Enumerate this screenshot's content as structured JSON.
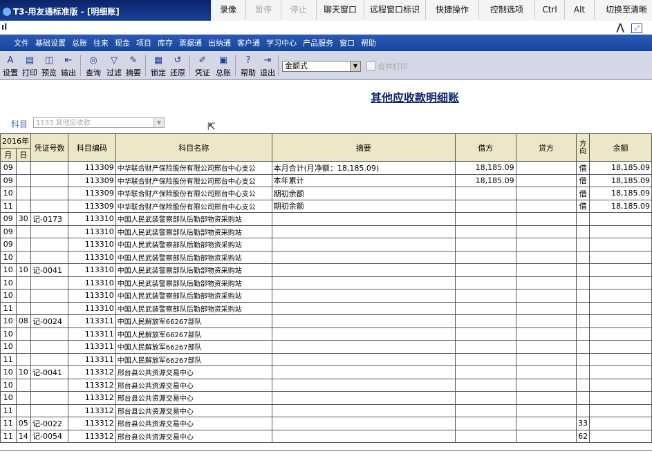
{
  "window": {
    "title": "T3-用友通标准版 - [明细账]"
  },
  "remote_toolbar": [
    {
      "label": "录像",
      "enabled": true
    },
    {
      "label": "暂停",
      "enabled": false
    },
    {
      "label": "停止",
      "enabled": false
    },
    {
      "label": "聊天窗口",
      "enabled": true
    },
    {
      "label": "远程窗口标识",
      "enabled": true
    },
    {
      "label": "快捷操作",
      "enabled": true
    },
    {
      "label": "控制选项",
      "enabled": true
    },
    {
      "label": "Ctrl",
      "enabled": true
    },
    {
      "label": "Alt",
      "enabled": true
    },
    {
      "label": "切换至清晰",
      "enabled": true
    }
  ],
  "menu": [
    "文件",
    "基础设置",
    "总账",
    "往来",
    "现金",
    "项目",
    "库存",
    "票据通",
    "出纳通",
    "客户通",
    "学习中心",
    "产品服务",
    "窗口",
    "帮助"
  ],
  "toolbar": {
    "buttons": [
      {
        "label": "设置",
        "icon": "settings-icon",
        "glyph": "A"
      },
      {
        "label": "打印",
        "icon": "printer-icon",
        "glyph": "▤"
      },
      {
        "label": "预览",
        "icon": "preview-icon",
        "glyph": "◫"
      },
      {
        "label": "输出",
        "icon": "export-icon",
        "glyph": "⇤"
      },
      {
        "label": "查询",
        "icon": "binoculars-icon",
        "glyph": "◎"
      },
      {
        "label": "过滤",
        "icon": "filter-icon",
        "glyph": "▽"
      },
      {
        "label": "摘要",
        "icon": "summary-icon",
        "glyph": "✎"
      },
      {
        "label": "锁定",
        "icon": "lock-icon",
        "glyph": "▦"
      },
      {
        "label": "还原",
        "icon": "restore-icon",
        "glyph": "↺"
      },
      {
        "label": "凭证",
        "icon": "voucher-icon",
        "glyph": "✐"
      },
      {
        "label": "总账",
        "icon": "ledger-icon",
        "glyph": "▣"
      },
      {
        "label": "帮助",
        "icon": "help-icon",
        "glyph": "?"
      },
      {
        "label": "退出",
        "icon": "exit-icon",
        "glyph": "⇥"
      }
    ],
    "format_select": "金额式",
    "merge_print_label": "合并打印"
  },
  "report": {
    "title": "其他应收款明细账",
    "subject_label": "科目",
    "subject_value": "1133 其他应收款"
  },
  "table": {
    "headers": {
      "year": "2016年",
      "month": "月",
      "day": "日",
      "voucher": "凭证号数",
      "code": "科目编码",
      "name": "科目名称",
      "summary": "摘要",
      "debit": "借方",
      "credit": "贷方",
      "direction": "方向",
      "balance": "余额"
    },
    "rows": [
      {
        "m": "09",
        "d": "",
        "v": "",
        "code": "113309",
        "name": "中华联合财产保险股份有限公司邢台中心支公",
        "sum": "本月合计(月净额：18,185.09)",
        "debit": "18,185.09",
        "credit": "",
        "dir": "借",
        "bal": "18,185.09"
      },
      {
        "m": "09",
        "d": "",
        "v": "",
        "code": "113309",
        "name": "中华联合财产保险股份有限公司邢台中心支公",
        "sum": "本年累计",
        "debit": "18,185.09",
        "credit": "",
        "dir": "借",
        "bal": "18,185.09"
      },
      {
        "m": "10",
        "d": "",
        "v": "",
        "code": "113309",
        "name": "中华联合财产保险股份有限公司邢台中心支公",
        "sum": "期初余额",
        "debit": "",
        "credit": "",
        "dir": "借",
        "bal": "18,185.09"
      },
      {
        "m": "11",
        "d": "",
        "v": "",
        "code": "113309",
        "name": "中华联合财产保险股份有限公司邢台中心支公",
        "sum": "期初余额",
        "debit": "",
        "credit": "",
        "dir": "借",
        "bal": "18,185.09"
      },
      {
        "m": "09",
        "d": "30",
        "v": "记-0173",
        "code": "113310",
        "name": "中国人民武装警察部队后勤部物资采购站",
        "sum": "",
        "debit": "",
        "credit": "",
        "dir": "",
        "bal": ""
      },
      {
        "m": "09",
        "d": "",
        "v": "",
        "code": "113310",
        "name": "中国人民武装警察部队后勤部物资采购站",
        "sum": "",
        "debit": "",
        "credit": "",
        "dir": "",
        "bal": ""
      },
      {
        "m": "09",
        "d": "",
        "v": "",
        "code": "113310",
        "name": "中国人民武装警察部队后勤部物资采购站",
        "sum": "",
        "debit": "",
        "credit": "",
        "dir": "",
        "bal": ""
      },
      {
        "m": "10",
        "d": "",
        "v": "",
        "code": "113310",
        "name": "中国人民武装警察部队后勤部物资采购站",
        "sum": "",
        "debit": "",
        "credit": "",
        "dir": "",
        "bal": ""
      },
      {
        "m": "10",
        "d": "10",
        "v": "记-0041",
        "code": "113310",
        "name": "中国人民武装警察部队后勤部物资采购站",
        "sum": "",
        "debit": "",
        "credit": "",
        "dir": "",
        "bal": ""
      },
      {
        "m": "10",
        "d": "",
        "v": "",
        "code": "113310",
        "name": "中国人民武装警察部队后勤部物资采购站",
        "sum": "",
        "debit": "",
        "credit": "",
        "dir": "",
        "bal": ""
      },
      {
        "m": "10",
        "d": "",
        "v": "",
        "code": "113310",
        "name": "中国人民武装警察部队后勤部物资采购站",
        "sum": "",
        "debit": "",
        "credit": "",
        "dir": "",
        "bal": ""
      },
      {
        "m": "11",
        "d": "",
        "v": "",
        "code": "113310",
        "name": "中国人民武装警察部队后勤部物资采购站",
        "sum": "",
        "debit": "",
        "credit": "",
        "dir": "",
        "bal": ""
      },
      {
        "m": "10",
        "d": "08",
        "v": "记-0024",
        "code": "113311",
        "name": "中国人民解放军66267部队",
        "sum": "",
        "debit": "",
        "credit": "",
        "dir": "",
        "bal": ""
      },
      {
        "m": "10",
        "d": "",
        "v": "",
        "code": "113311",
        "name": "中国人民解放军66267部队",
        "sum": "",
        "debit": "",
        "credit": "",
        "dir": "",
        "bal": ""
      },
      {
        "m": "10",
        "d": "",
        "v": "",
        "code": "113311",
        "name": "中国人民解放军66267部队",
        "sum": "",
        "debit": "",
        "credit": "",
        "dir": "",
        "bal": ""
      },
      {
        "m": "11",
        "d": "",
        "v": "",
        "code": "113311",
        "name": "中国人民解放军66267部队",
        "sum": "",
        "debit": "",
        "credit": "",
        "dir": "",
        "bal": ""
      },
      {
        "m": "10",
        "d": "10",
        "v": "记-0041",
        "code": "113312",
        "name": "邢台县公共资源交易中心",
        "sum": "",
        "debit": "",
        "credit": "",
        "dir": "",
        "bal": ""
      },
      {
        "m": "10",
        "d": "",
        "v": "",
        "code": "113312",
        "name": "邢台县公共资源交易中心",
        "sum": "",
        "debit": "",
        "credit": "",
        "dir": "",
        "bal": ""
      },
      {
        "m": "10",
        "d": "",
        "v": "",
        "code": "113312",
        "name": "邢台县公共资源交易中心",
        "sum": "",
        "debit": "",
        "credit": "",
        "dir": "",
        "bal": ""
      },
      {
        "m": "11",
        "d": "",
        "v": "",
        "code": "113312",
        "name": "邢台县公共资源交易中心",
        "sum": "",
        "debit": "",
        "credit": "",
        "dir": "",
        "bal": ""
      },
      {
        "m": "11",
        "d": "05",
        "v": "记-0022",
        "code": "113312",
        "name": "邢台县公共资源交易中心",
        "sum": "",
        "debit": "",
        "credit": "",
        "dir": "33",
        "bal": ""
      },
      {
        "m": "11",
        "d": "14",
        "v": "记-0054",
        "code": "113312",
        "name": "邢台县公共资源交易中心",
        "sum": "",
        "debit": "",
        "credit": "",
        "dir": "62",
        "bal": ""
      }
    ]
  },
  "colors": {
    "menubar": "#1e4fa8",
    "header_bg": "#ede7c8",
    "title": "#0a246a"
  }
}
